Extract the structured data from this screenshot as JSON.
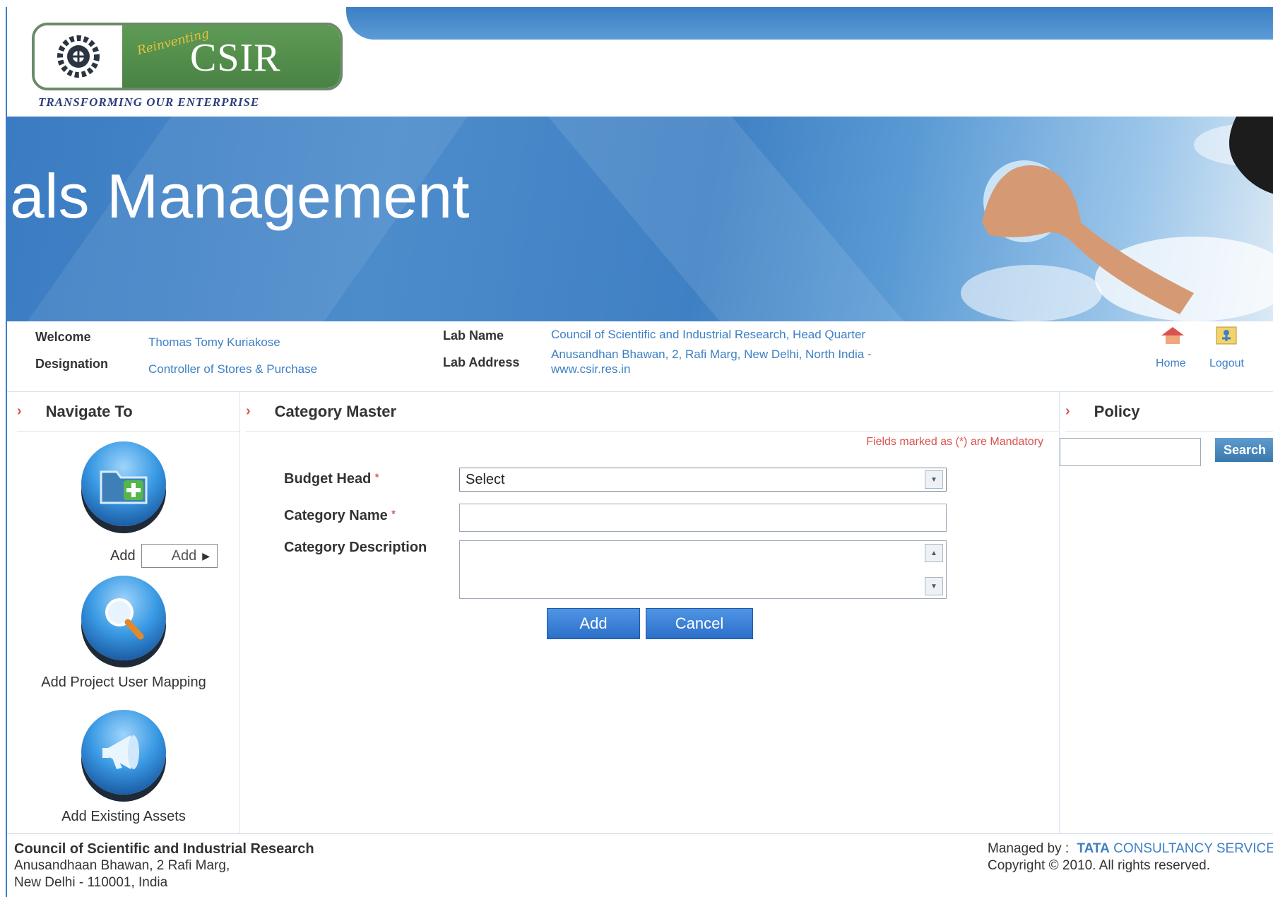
{
  "header": {
    "logo_reinventing": "Reinventing",
    "logo_csir": "CSIR",
    "logo_tagline": "TRANSFORMING OUR ENTERPRISE",
    "banner_title": "als Management"
  },
  "user_info": {
    "welcome_label": "Welcome",
    "welcome_value": "Thomas Tomy Kuriakose",
    "designation_label": "Designation",
    "designation_value": "Controller of Stores & Purchase",
    "lab_name_label": "Lab Name",
    "lab_name_value": "Council of Scientific and Industrial Research, Head Quarter",
    "lab_address_label": "Lab Address",
    "lab_address_line1": "Anusandhan Bhawan, 2, Rafi Marg, New Delhi, North India -",
    "lab_address_line2": "www.csir.res.in",
    "home_label": "Home",
    "logout_label": "Logout"
  },
  "navigate": {
    "title": "Navigate To",
    "items": [
      {
        "label": "Add",
        "icon": "folder-add-icon"
      },
      {
        "label": "Add Project User Mapping",
        "icon": "magnifier-icon"
      },
      {
        "label": "Add Existing Assets",
        "icon": "megaphone-icon"
      }
    ],
    "add_dropdown_label": "Add"
  },
  "category_master": {
    "title": "Category Master",
    "mandatory_note": "Fields marked as (*) are Mandatory",
    "budget_head_label": "Budget Head",
    "budget_head_value": "Select",
    "category_name_label": "Category Name",
    "category_name_value": "",
    "category_description_label": "Category Description",
    "category_description_value": "",
    "add_button": "Add",
    "cancel_button": "Cancel"
  },
  "policy": {
    "title": "Policy",
    "search_value": "",
    "search_button": "Search"
  },
  "footer": {
    "org_name": "Council of Scientific and Industrial Research",
    "address_line1": "Anusandhaan Bhawan, 2 Rafi Marg,",
    "address_line2": "New Delhi - 110001, India",
    "managed_by_label": "Managed by :",
    "managed_by_tata": "TATA",
    "managed_by_rest": "CONSULTANCY SERVICES",
    "copyright": "Copyright © 2010. All rights reserved."
  },
  "colors": {
    "accent_blue": "#3d7fc4",
    "button_blue": "#2c6fc9",
    "required_red": "#d9534f",
    "logo_green": "#4a8243"
  }
}
